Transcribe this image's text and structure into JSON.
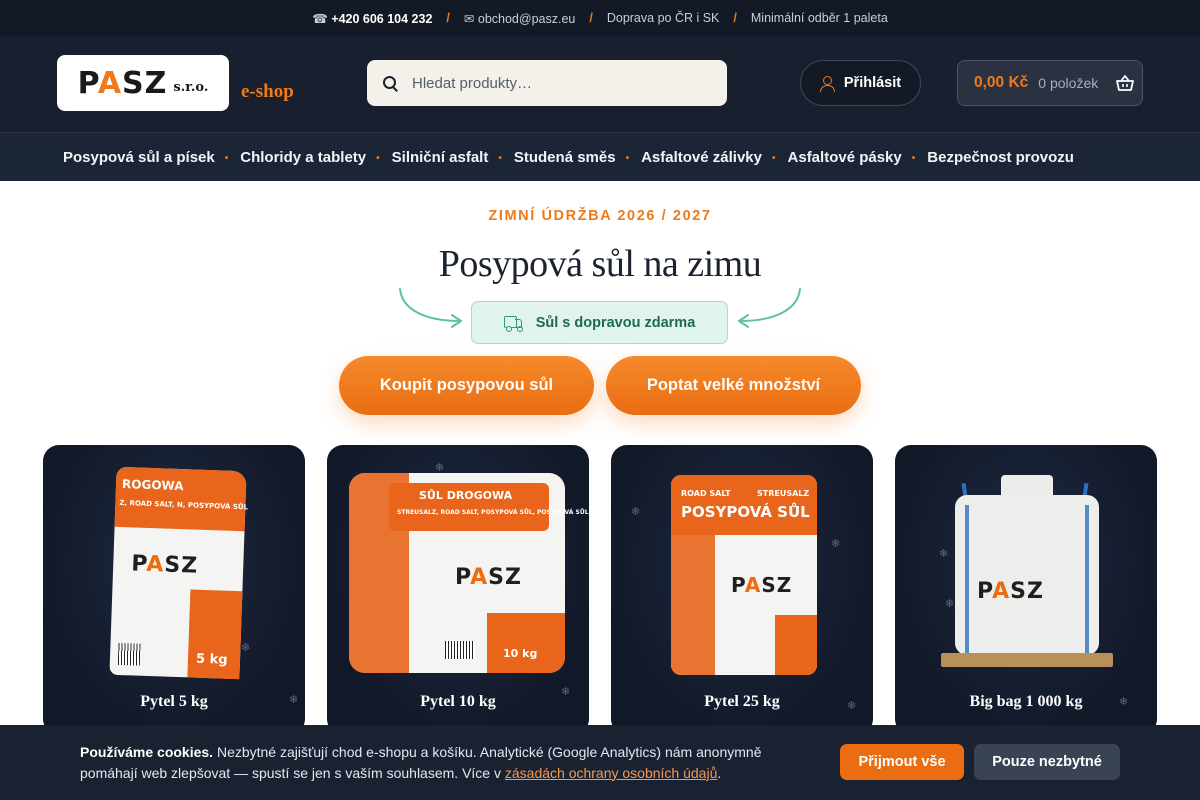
{
  "topbar": {
    "phone_icon": "☎",
    "phone": "+420 606 104 232",
    "email_icon": "✉",
    "email": "obchod@pasz.eu",
    "delivery": "Doprava po ČR i SK",
    "min_order": "Minimální odběr 1 paleta",
    "separator": "/"
  },
  "header": {
    "logo_main_1": "P",
    "logo_main_a": "A",
    "logo_main_2": "SZ",
    "logo_sub": "s.r.o.",
    "eshop": "e-shop",
    "search_placeholder": "Hledat produkty…",
    "login_label": "Přihlásit",
    "cart_price": "0,00 Kč",
    "cart_count": "0 položek",
    "basket_icon": "basket-icon"
  },
  "nav": {
    "items": [
      {
        "label": "Posypová sůl a písek"
      },
      {
        "label": "Chloridy a tablety"
      },
      {
        "label": "Silniční asfalt"
      },
      {
        "label": "Studená směs"
      },
      {
        "label": "Asfaltové zálivky"
      },
      {
        "label": "Asfaltové pásky"
      },
      {
        "label": "Bezpečnost provozu"
      }
    ],
    "dot": "•"
  },
  "hero": {
    "kicker": "ZIMNÍ ÚDRŽBA 2026 / 2027",
    "title": "Posypová sůl na zimu",
    "badge": "Sůl s dopravou zdarma",
    "cta_primary": "Koupit posypovou sůl",
    "cta_secondary": "Poptat velké množství",
    "accent_color": "#f07a1a",
    "badge_color": "#e1f4ec"
  },
  "products": [
    {
      "label": "Pytel 5 kg",
      "bag_text": "ROGOWA",
      "bag_sub": "Z, ROAD SALT, N, POSYPOVÁ SŮL",
      "weight": "5 kg"
    },
    {
      "label": "Pytel 10 kg",
      "bag_text": "SŮL DROGOWA",
      "bag_sub": "STREUSALZ, ROAD SALT, POSYPOVÁ SŮL, POSYPOVÁ SŮL",
      "weight": "10 kg"
    },
    {
      "label": "Pytel 25 kg",
      "bag_text": "POSYPOVÁ SŮL",
      "bag_top_left": "ROAD SALT",
      "bag_top_right": "STREUSALZ"
    },
    {
      "label": "Big bag 1 000 kg"
    }
  ],
  "brand": {
    "p": "P",
    "a": "A",
    "sz": "SZ"
  },
  "cookie": {
    "title": "Používáme cookies.",
    "text": " Nezbytné zajišťují chod e-shopu a košíku. Analytické (Google Analytics) nám anonymně pomáhají web zlepšovat — spustí se jen s vaším souhlasem. Více v ",
    "link": "zásadách ochrany osobních údajů",
    "end": ".",
    "accept": "Přijmout vše",
    "necessary": "Pouze nezbytné"
  }
}
